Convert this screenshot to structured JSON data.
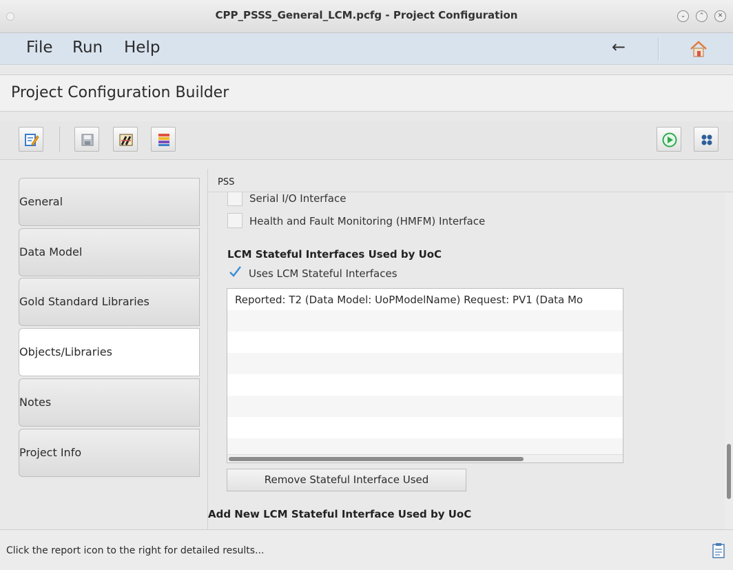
{
  "window": {
    "title": "CPP_PSSS_General_LCM.pcfg - Project Configuration",
    "controls": [
      "minimize",
      "maximize",
      "close"
    ]
  },
  "menu": {
    "items": [
      "File",
      "Run",
      "Help"
    ],
    "icons": [
      "back-arrow-icon",
      "home-icon"
    ]
  },
  "builder": {
    "title": "Project Configuration Builder"
  },
  "toolbar": {
    "buttons": [
      "edit-icon",
      "save-icon",
      "validate-icon",
      "library-icon",
      "run-icon",
      "settings-icon"
    ]
  },
  "sidebar": {
    "tabs": [
      {
        "label": "General"
      },
      {
        "label": "Data Model"
      },
      {
        "label": "Gold Standard Libraries"
      },
      {
        "label": "Objects/Libraries",
        "active": true
      },
      {
        "label": "Notes"
      },
      {
        "label": "Project Info"
      }
    ]
  },
  "main": {
    "header": "PSS",
    "checkboxes": [
      {
        "label": "Serial I/O Interface",
        "checked": false
      },
      {
        "label": "Health and Fault Monitoring (HMFM) Interface",
        "checked": false
      }
    ],
    "stateful_section_title": "LCM Stateful Interfaces Used by UoC",
    "uses_stateful": {
      "label": "Uses LCM Stateful Interfaces",
      "checked": true
    },
    "stateful_list": [
      "Reported: T2 (Data Model: UoPModelName) Request: PV1 (Data Mo"
    ],
    "remove_button": "Remove Stateful Interface Used",
    "add_section_title": "Add New LCM Stateful Interface Used by UoC"
  },
  "status": {
    "text": "Click the report icon to the right for detailed results..."
  },
  "colors": {
    "menubar": "#d9e3ee",
    "check_accent": "#3b8ed6",
    "run_green": "#2fa84f"
  }
}
